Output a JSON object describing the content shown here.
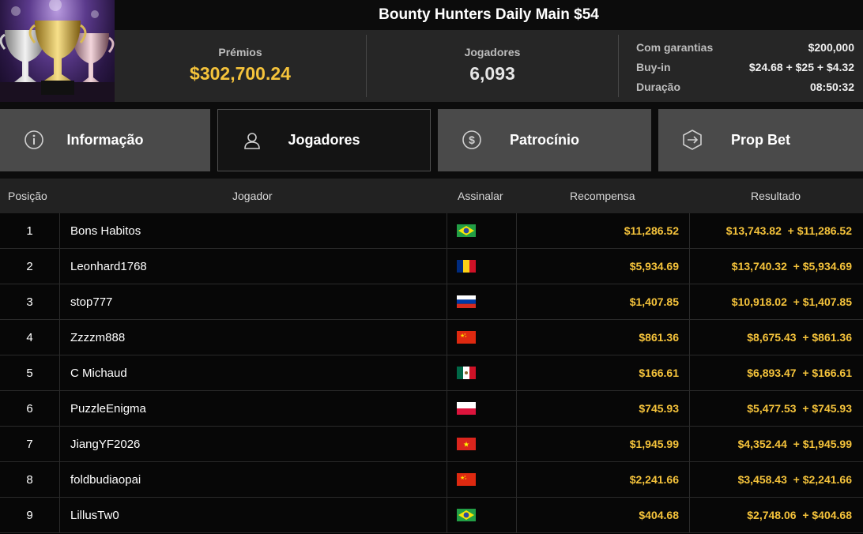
{
  "header": {
    "title": "Bounty Hunters Daily Main $54",
    "prizes_label": "Prémios",
    "prizes_value": "$302,700.24",
    "players_label": "Jogadores",
    "players_value": "6,093",
    "details": [
      {
        "label": "Com garantias",
        "value": "$200,000"
      },
      {
        "label": "Buy-in",
        "value": "$24.68 + $25 + $4.32"
      },
      {
        "label": "Duração",
        "value": "08:50:32"
      }
    ]
  },
  "tabs": [
    {
      "label": "Informação",
      "icon": "info-icon",
      "active": false
    },
    {
      "label": "Jogadores",
      "icon": "user-icon",
      "active": true
    },
    {
      "label": "Patrocínio",
      "icon": "dollar-coin-icon",
      "active": false
    },
    {
      "label": "Prop Bet",
      "icon": "prop-bet-icon",
      "active": false
    }
  ],
  "table": {
    "columns": [
      "Posição",
      "Jogador",
      "Assinalar",
      "Recompensa",
      "Resultado"
    ],
    "rows": [
      {
        "pos": "1",
        "name": "Bons Habitos",
        "flag": "BR",
        "reward": "$11,286.52",
        "result": "$13,743.82  + $11,286.52"
      },
      {
        "pos": "2",
        "name": "Leonhard1768",
        "flag": "RO",
        "reward": "$5,934.69",
        "result": "$13,740.32  + $5,934.69"
      },
      {
        "pos": "3",
        "name": "stop777",
        "flag": "RU",
        "reward": "$1,407.85",
        "result": "$10,918.02  + $1,407.85"
      },
      {
        "pos": "4",
        "name": "Zzzzm888",
        "flag": "CN",
        "reward": "$861.36",
        "result": "$8,675.43  + $861.36"
      },
      {
        "pos": "5",
        "name": "C Michaud",
        "flag": "MX",
        "reward": "$166.61",
        "result": "$6,893.47  + $166.61"
      },
      {
        "pos": "6",
        "name": "PuzzleEnigma",
        "flag": "PL",
        "reward": "$745.93",
        "result": "$5,477.53  + $745.93"
      },
      {
        "pos": "7",
        "name": "JiangYF2026",
        "flag": "VN",
        "reward": "$1,945.99",
        "result": "$4,352.44  + $1,945.99"
      },
      {
        "pos": "8",
        "name": "foldbudiaopai",
        "flag": "CN",
        "reward": "$2,241.66",
        "result": "$3,458.43  + $2,241.66"
      },
      {
        "pos": "9",
        "name": "LillusTw0",
        "flag": "BR",
        "reward": "$404.68",
        "result": "$2,748.06  + $404.68"
      }
    ]
  },
  "colors": {
    "accent_gold": "#f5c33b",
    "tab_bg": "#4a4a4a",
    "tab_active_bg": "#141414"
  }
}
